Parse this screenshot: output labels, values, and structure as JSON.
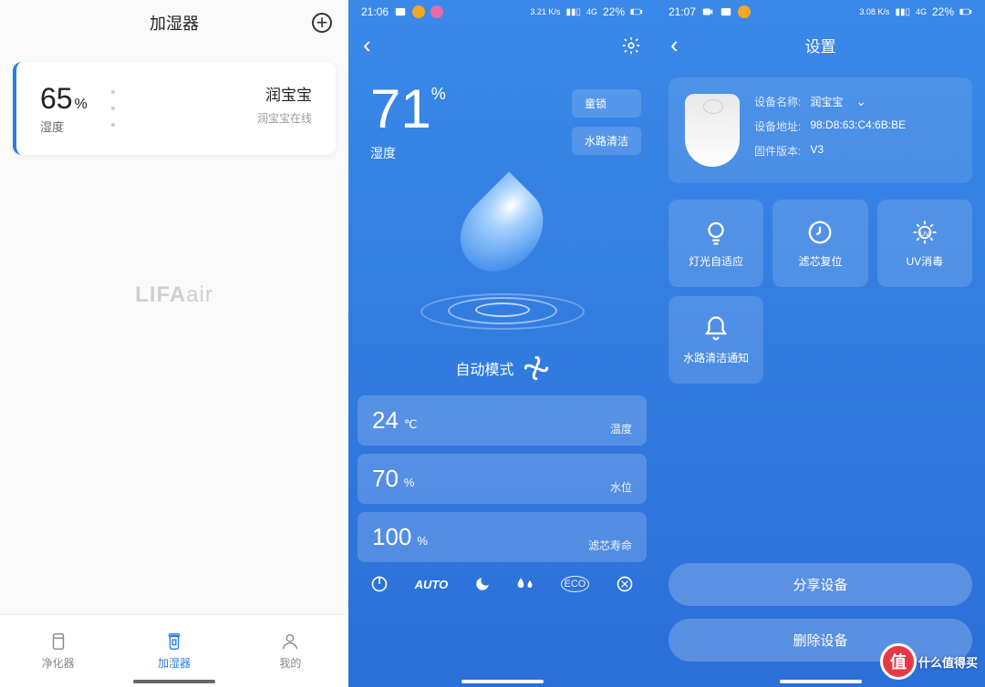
{
  "screen1": {
    "title": "加湿器",
    "card": {
      "humidity_value": "65",
      "humidity_unit": "%",
      "humidity_label": "湿度",
      "device_name": "润宝宝",
      "device_status": "润宝宝在线"
    },
    "brand_bold": "LIFA",
    "brand_light": "air",
    "tabs": [
      {
        "label": "净化器"
      },
      {
        "label": "加湿器"
      },
      {
        "label": "我的"
      }
    ]
  },
  "screen2": {
    "status_time": "21:06",
    "status_speed": "3.21 K/s",
    "status_net": "4G",
    "status_battery": "22%",
    "humidity_value": "71",
    "humidity_unit": "%",
    "humidity_label": "湿度",
    "pills": [
      {
        "label": "童锁"
      },
      {
        "label": "水路清洁"
      }
    ],
    "mode_label": "自动模式",
    "stats": [
      {
        "value": "24",
        "unit": "℃",
        "label": "温度"
      },
      {
        "value": "70",
        "unit": "%",
        "label": "水位"
      },
      {
        "value": "100",
        "unit": "%",
        "label": "滤芯寿命"
      }
    ],
    "bottom_icons": [
      "power",
      "auto",
      "night",
      "humidity",
      "eco",
      "cycle"
    ],
    "auto_text": "AUTO",
    "eco_text": "ECO"
  },
  "screen3": {
    "status_time": "21:07",
    "status_speed": "3.08 K/s",
    "status_net": "4G",
    "status_battery": "22%",
    "title": "设置",
    "info": [
      {
        "label": "设备名称:",
        "value": "润宝宝",
        "editable": true
      },
      {
        "label": "设备地址:",
        "value": "98:D8:63:C4:6B:BE"
      },
      {
        "label": "固件版本:",
        "value": "V3"
      }
    ],
    "tiles": [
      {
        "label": "灯光自适应",
        "icon": "bulb"
      },
      {
        "label": "滤芯复位",
        "icon": "reset"
      },
      {
        "label": "UV消毒",
        "icon": "uv"
      },
      {
        "label": "水路清洁通知",
        "icon": "bell"
      }
    ],
    "share_btn": "分享设备",
    "delete_btn": "删除设备"
  },
  "watermark": {
    "badge": "值",
    "text": "什么值得买"
  }
}
